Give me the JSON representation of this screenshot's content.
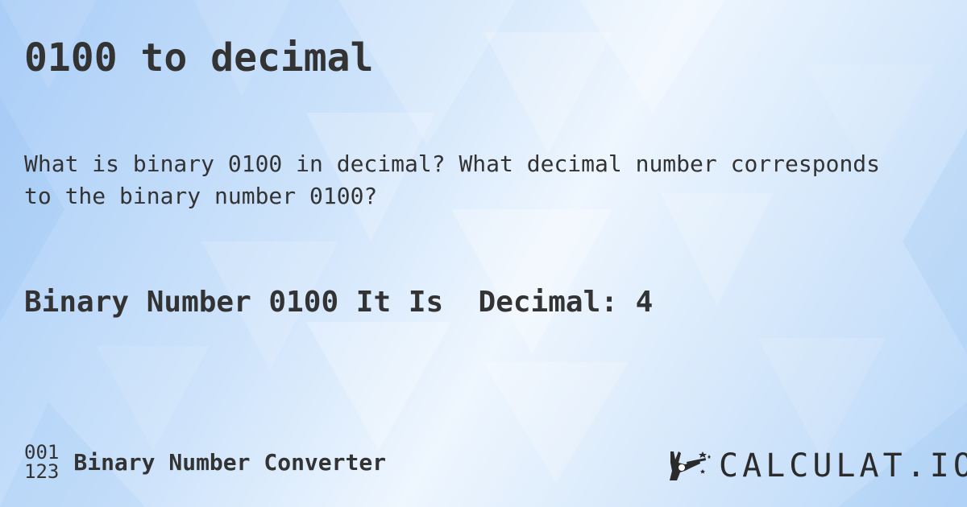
{
  "page": {
    "title": "0100 to decimal",
    "question": "What is binary 0100 in decimal? What decimal number corresponds to the binary number 0100?",
    "answer": "Binary Number 0100 It Is  Decimal: 4"
  },
  "footer": {
    "icon_line1": "001",
    "icon_line2": "123",
    "icon_name": "binary-number-icon",
    "brand_name": "Binary Number Converter",
    "logo_text": "CALCULAT.IO",
    "logo_icon": "magic-hand-wand-icon"
  },
  "colors": {
    "text": "#333333",
    "background_light": "#eef6fe",
    "background_dark": "#a9cdf7"
  }
}
